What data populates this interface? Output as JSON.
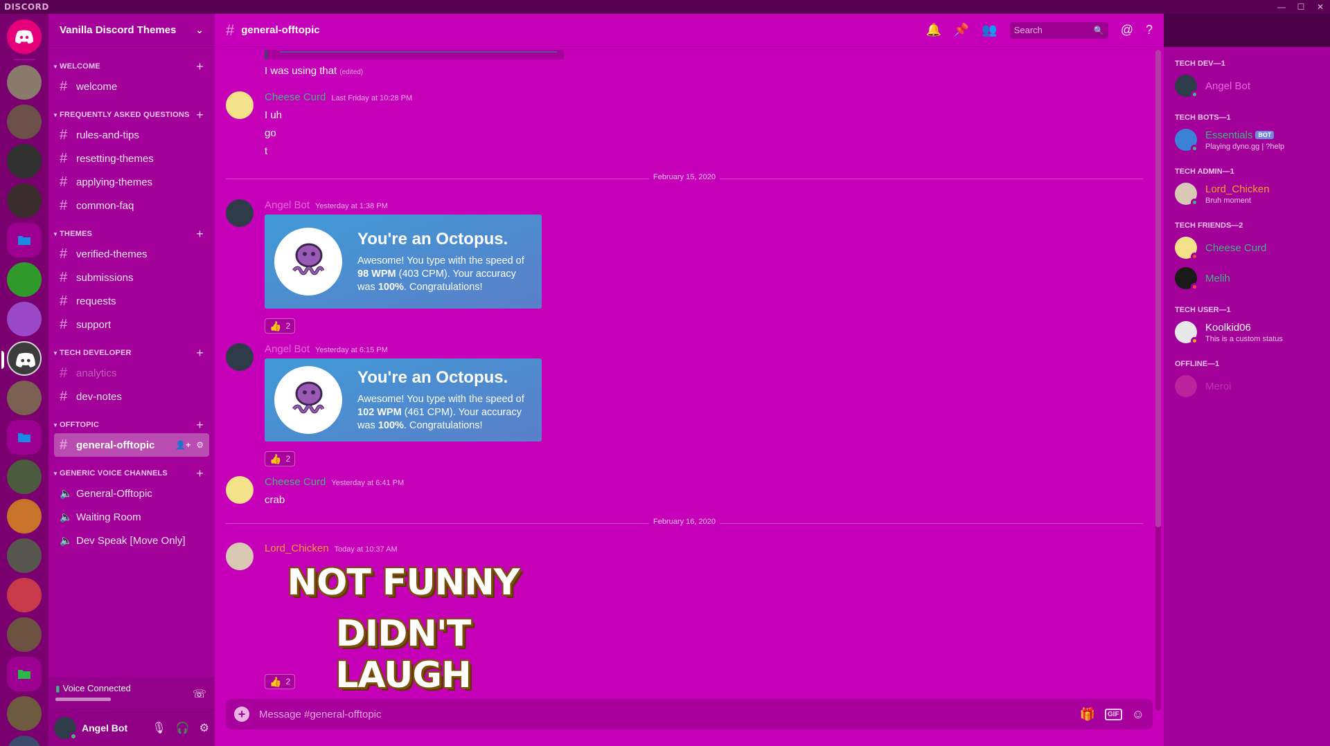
{
  "app": {
    "brand": "DISCORD"
  },
  "window_controls": [
    "—",
    "☐",
    "✕"
  ],
  "colors": {
    "accent": "#c600b8",
    "sidebar": "#a3009a",
    "rail": "#7a0070",
    "online": "#43b581",
    "dnd": "#f04747",
    "idle": "#faa61a",
    "bot_tag": "#7289da"
  },
  "server": {
    "name": "Vanilla Discord Themes"
  },
  "rail": {
    "servers": [
      {
        "kind": "home",
        "color": "#e6007a"
      },
      {
        "kind": "server",
        "color": "#8a7a6b"
      },
      {
        "kind": "server",
        "color": "#6b4f49"
      },
      {
        "kind": "server",
        "color": "#303030"
      },
      {
        "kind": "server",
        "color": "#3a2c2c"
      },
      {
        "kind": "folder",
        "color": "#1e88e5"
      },
      {
        "kind": "server",
        "color": "#2f9a2a"
      },
      {
        "kind": "server",
        "color": "#9a48c8"
      },
      {
        "kind": "active",
        "color": "#3c3c3c"
      },
      {
        "kind": "server",
        "color": "#7b6151"
      },
      {
        "kind": "folder",
        "color": "#1e88e5"
      },
      {
        "kind": "server",
        "color": "#4c5a3d"
      },
      {
        "kind": "server",
        "color": "#c7732a"
      },
      {
        "kind": "server",
        "color": "#56564e"
      },
      {
        "kind": "server",
        "color": "#c8394a"
      },
      {
        "kind": "server",
        "color": "#6d5141"
      },
      {
        "kind": "folder",
        "color": "#2bb84a"
      },
      {
        "kind": "server",
        "color": "#6d5a3f"
      },
      {
        "kind": "server",
        "color": "#3a4a6a"
      }
    ]
  },
  "categories": [
    {
      "name": "WELCOME",
      "channels": [
        {
          "name": "welcome",
          "type": "text"
        }
      ]
    },
    {
      "name": "FREQUENTLY ASKED QUESTIONS",
      "channels": [
        {
          "name": "rules-and-tips",
          "type": "text"
        },
        {
          "name": "resetting-themes",
          "type": "text"
        },
        {
          "name": "applying-themes",
          "type": "text"
        },
        {
          "name": "common-faq",
          "type": "text"
        }
      ]
    },
    {
      "name": "THEMES",
      "channels": [
        {
          "name": "verified-themes",
          "type": "text"
        },
        {
          "name": "submissions",
          "type": "text"
        },
        {
          "name": "requests",
          "type": "text"
        },
        {
          "name": "support",
          "type": "text"
        }
      ]
    },
    {
      "name": "TECH DEVELOPER",
      "channels": [
        {
          "name": "analytics",
          "type": "text",
          "muted": true
        },
        {
          "name": "dev-notes",
          "type": "text"
        }
      ]
    },
    {
      "name": "OFFTOPIC",
      "channels": [
        {
          "name": "general-offtopic",
          "type": "text",
          "active": true
        }
      ]
    },
    {
      "name": "GENERIC VOICE CHANNELS",
      "channels": [
        {
          "name": "General-Offtopic",
          "type": "voice"
        },
        {
          "name": "Waiting Room",
          "type": "voice"
        },
        {
          "name": "Dev Speak [Move Only]",
          "type": "voice"
        }
      ]
    }
  ],
  "voice": {
    "status": "Voice Connected"
  },
  "user": {
    "name": "Angel Bot"
  },
  "channel": {
    "name": "general-offtopic"
  },
  "search": {
    "placeholder": "Search"
  },
  "composer": {
    "placeholder": "Message #general-offtopic",
    "gif_label": "GIF"
  },
  "messages": {
    "top_line": "I was using that",
    "top_edited": "(edited)",
    "m1": {
      "author": "Cheese Curd",
      "color": "#43b581",
      "time": "Last Friday at 10:28 PM",
      "lines": [
        "I uh",
        "go",
        "t"
      ]
    },
    "d1": "February 15, 2020",
    "m2": {
      "author": "Angel Bot",
      "color": "#e86bdb",
      "time": "Yesterday at 1:38 PM",
      "card_title": "You're an Octopus.",
      "card_pre": "Awesome! You type with the speed of ",
      "card_wpm": "98 WPM",
      "card_mid": " (403 CPM). Your accuracy was ",
      "card_acc": "100%",
      "card_post": ". Congratulations!",
      "reaction_count": "2"
    },
    "m3": {
      "author": "Angel Bot",
      "color": "#e86bdb",
      "time": "Yesterday at 6:15 PM",
      "card_title": "You're an Octopus.",
      "card_pre": "Awesome! You type with the speed of ",
      "card_wpm": "102 WPM",
      "card_mid": " (461 CPM). Your accuracy was ",
      "card_acc": "100%",
      "card_post": ". Congratulations!",
      "reaction_count": "2"
    },
    "m4": {
      "author": "Cheese Curd",
      "color": "#43b581",
      "time": "Yesterday at 6:41 PM",
      "lines": [
        "crab"
      ]
    },
    "d2": "February 16, 2020",
    "m5": {
      "author": "Lord_Chicken",
      "color": "#f0a030",
      "time": "Today at 10:37 AM",
      "meme_line1": "NOT FUNNY",
      "meme_line2": "DIDN'T LAUGH",
      "reaction_count": "2"
    }
  },
  "members": {
    "groups": [
      {
        "title": "TECH DEV—1",
        "members": [
          {
            "name": "Angel Bot",
            "color": "#e86bdb",
            "status": "online",
            "avatar": "#2e3c4a"
          }
        ]
      },
      {
        "title": "TECH BOTS—1",
        "members": [
          {
            "name": "Essentials",
            "color": "#43b581",
            "bot": "BOT",
            "activity": "Playing dyno.gg | ?help",
            "status": "online",
            "avatar": "#3b82d6"
          }
        ]
      },
      {
        "title": "TECH ADMIN—1",
        "members": [
          {
            "name": "Lord_Chicken",
            "color": "#f0a030",
            "activity": "Bruh moment",
            "status": "online",
            "avatar": "#d9c9b4"
          }
        ]
      },
      {
        "title": "TECH FRIENDS—2",
        "members": [
          {
            "name": "Cheese Curd",
            "color": "#43b581",
            "status": "dnd",
            "avatar": "#f4e28a"
          },
          {
            "name": "Melih",
            "color": "#43b581",
            "status": "dnd",
            "avatar": "#1a1a1a"
          }
        ]
      },
      {
        "title": "TECH USER—1",
        "members": [
          {
            "name": "Koolkid06",
            "color": "#ffffff",
            "activity": "This is a custom status",
            "status": "idle",
            "avatar": "#e8e8e8"
          }
        ]
      },
      {
        "title": "OFFLINE—1",
        "members": [
          {
            "name": "Meroi",
            "color": "#e086d8",
            "status": "offline",
            "avatar": "#e057a6",
            "offline": true
          }
        ]
      }
    ]
  }
}
